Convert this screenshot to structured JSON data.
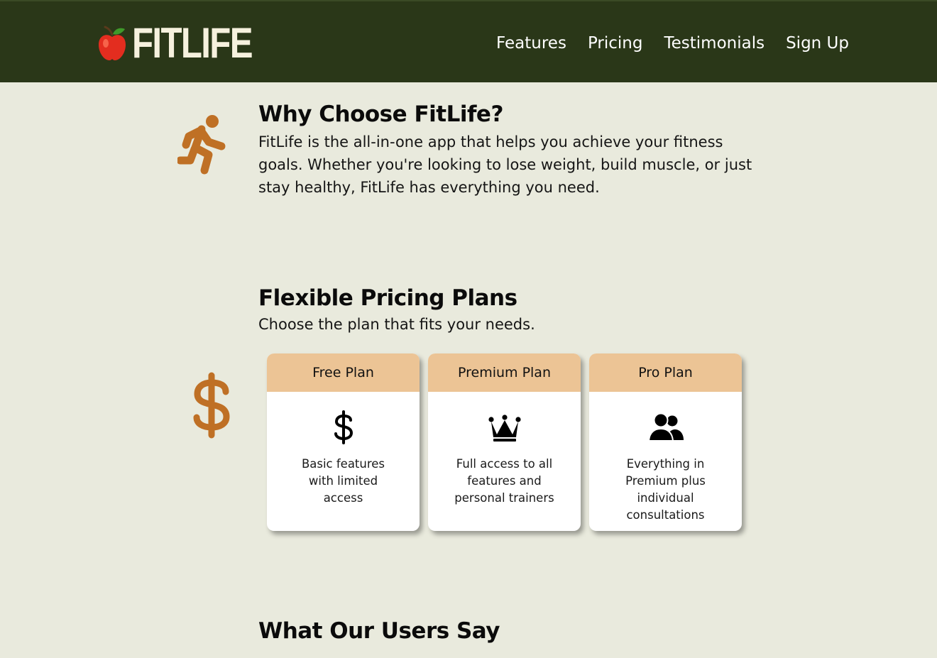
{
  "brand": {
    "logo_text": "FITLIFE",
    "logo_icon": "apple-icon",
    "header_bg": "#2a3718"
  },
  "nav": {
    "items": [
      {
        "label": "Features"
      },
      {
        "label": "Pricing"
      },
      {
        "label": "Testimonials"
      },
      {
        "label": "Sign Up"
      }
    ]
  },
  "why": {
    "icon": "running-person-icon",
    "title": "Why Choose FitLife?",
    "text": "FitLife is the all-in-one app that helps you achieve your fitness goals. Whether you're looking to lose weight, build muscle, or just stay healthy, FitLife has everything you need."
  },
  "pricing": {
    "icon": "dollar-icon",
    "title": "Flexible Pricing Plans",
    "subtitle": "Choose the plan that fits your needs.",
    "plans": [
      {
        "name": "Free Plan",
        "icon": "dollar-icon",
        "description": "Basic features with limited access"
      },
      {
        "name": "Premium Plan",
        "icon": "crown-icon",
        "description": "Full access to all features and personal trainers"
      },
      {
        "name": "Pro Plan",
        "icon": "users-icon",
        "description": "Everything in Premium plus individual consultations"
      }
    ]
  },
  "testimonials": {
    "title": "What Our Users Say"
  },
  "colors": {
    "page_bg": "#e9eadd",
    "accent": "#bf7025",
    "card_header": "#ecc495"
  }
}
